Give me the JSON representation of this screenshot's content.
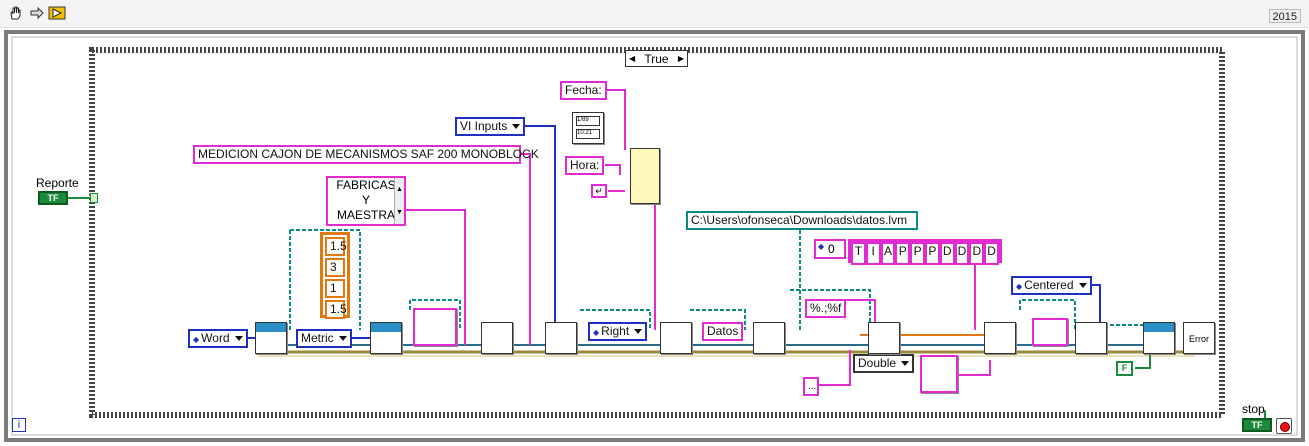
{
  "app": {
    "version": "2015"
  },
  "case_structure": {
    "selector": "True"
  },
  "controls": {
    "reporte": {
      "label": "Reporte",
      "terminal": "TF"
    },
    "stop": {
      "label": "stop",
      "terminal": "TF"
    }
  },
  "constants": {
    "report_type": "Word",
    "units": "Metric",
    "vi_inputs": "VI Inputs",
    "title_text": "MEDICION CAJON DE MECANISMOS SAF 200  MONOBLOCK",
    "multiline_text": [
      "FABRICAS",
      "Y",
      "MAESTRA"
    ],
    "margins_array": [
      "1.5",
      "3",
      "1",
      "1.5"
    ],
    "fecha": "Fecha:",
    "hora": "Hora:",
    "alignment": "Right",
    "datos": "Datos",
    "file_path": "C:\\Users\\ofonseca\\Downloads\\datos.lvm",
    "array_index": "0",
    "string_array": [
      "T",
      "I",
      "A",
      "P",
      "P",
      "P",
      "D",
      "D",
      "D",
      "D"
    ],
    "format_string": "%.;%f",
    "double_type": "Double",
    "table_alignment": "Centered",
    "false_const": "F",
    "empty_string": "...",
    "error_handler": "Error"
  },
  "info_icon": "i",
  "icons": [
    "hand-icon",
    "arrow-icon",
    "run-icon",
    "info-icon",
    "stop-icon"
  ]
}
